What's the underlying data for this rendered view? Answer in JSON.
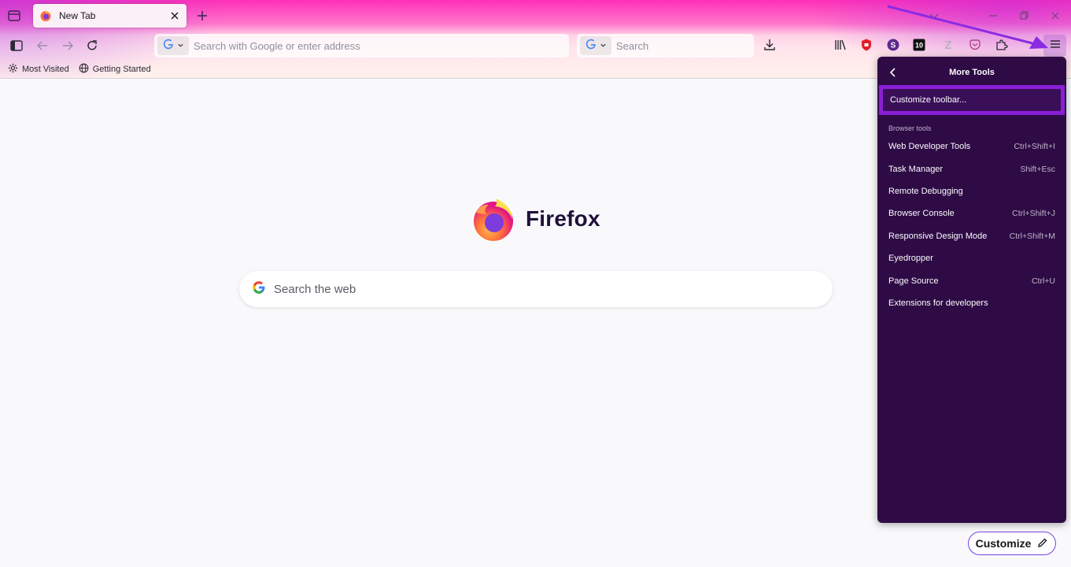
{
  "tab": {
    "title": "New Tab"
  },
  "toolbar": {
    "urlbar_placeholder": "Search with Google or enter address",
    "searchbar_placeholder": "Search"
  },
  "bookmarks": [
    {
      "label": "Most Visited",
      "icon": "gear-icon"
    },
    {
      "label": "Getting Started",
      "icon": "globe-icon"
    }
  ],
  "content": {
    "wordmark": "Firefox",
    "search_placeholder": "Search the web",
    "customize_label": "Customize"
  },
  "panel": {
    "title": "More Tools",
    "highlighted_item": "Customize toolbar...",
    "section_label": "Browser tools",
    "items": [
      {
        "label": "Web Developer Tools",
        "shortcut": "Ctrl+Shift+I"
      },
      {
        "label": "Task Manager",
        "shortcut": "Shift+Esc"
      },
      {
        "label": "Remote Debugging",
        "shortcut": ""
      },
      {
        "label": "Browser Console",
        "shortcut": "Ctrl+Shift+J"
      },
      {
        "label": "Responsive Design Mode",
        "shortcut": "Ctrl+Shift+M"
      },
      {
        "label": "Eyedropper",
        "shortcut": ""
      },
      {
        "label": "Page Source",
        "shortcut": "Ctrl+U"
      },
      {
        "label": "Extensions for developers",
        "shortcut": ""
      }
    ]
  },
  "extension_badges": {
    "s_badge": "S",
    "ten_badge": "10",
    "z_badge": "Z"
  },
  "colors": {
    "accent": "#7542e5",
    "panel_bg": "#2e0b45",
    "highlight_border": "#8a1fd6",
    "annotation_arrow": "#8a2be2"
  }
}
